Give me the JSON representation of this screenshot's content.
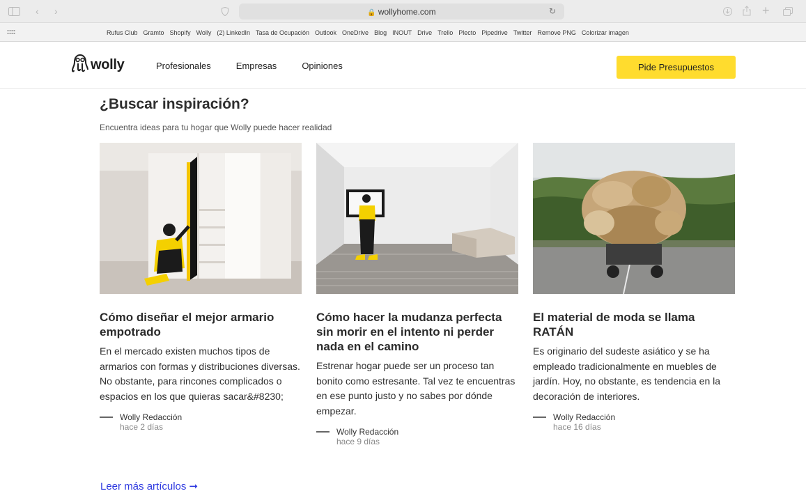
{
  "browser": {
    "url": "wollyhome.com",
    "bookmarks": [
      "Rufus Club",
      "Gramto",
      "Shopify",
      "Wolly",
      "(2) LinkedIn",
      "Tasa de Ocupación",
      "Outlook",
      "OneDrive",
      "Blog",
      "INOUT",
      "Drive",
      "Trello",
      "Plecto",
      "Pipedrive",
      "Twitter",
      "Remove PNG",
      "Colorizar imagen"
    ]
  },
  "header": {
    "logo_text": "wolly",
    "nav": [
      "Profesionales",
      "Empresas",
      "Opiniones"
    ],
    "cta": "Pide Presupuestos"
  },
  "section": {
    "title": "¿Buscar inspiración?",
    "subtitle": "Encuentra ideas para tu hogar que Wolly puede hacer realidad"
  },
  "cards": [
    {
      "title": "Cómo diseñar el mejor armario empotrado",
      "text": "En el mercado existen muchos tipos de armarios con formas y distribuciones diversas. No obstante, para rincones complicados o espacios en los que quieras sacar&#8230;",
      "author": "Wolly Redacción",
      "time": "hace 2 días"
    },
    {
      "title": "Cómo hacer la mudanza perfecta sin morir en el intento ni perder nada en el camino",
      "text": "Estrenar hogar puede ser un proceso tan bonito como estresante. Tal vez te encuentras en ese punto justo y no sabes por dónde empezar.",
      "author": "Wolly Redacción",
      "time": "hace 9 días"
    },
    {
      "title": "El material de moda se llama RATÁN",
      "text": "Es originario del sudeste asiático y se ha empleado tradicionalmente en muebles de jardín. Hoy, no obstante, es tendencia en la decoración de interiores.",
      "author": "Wolly Redacción",
      "time": "hace 16 días"
    }
  ],
  "read_more": "Leer más artículos ➞",
  "colors": {
    "accent_yellow": "#ffdc2e",
    "link_blue": "#2f3ae0"
  }
}
